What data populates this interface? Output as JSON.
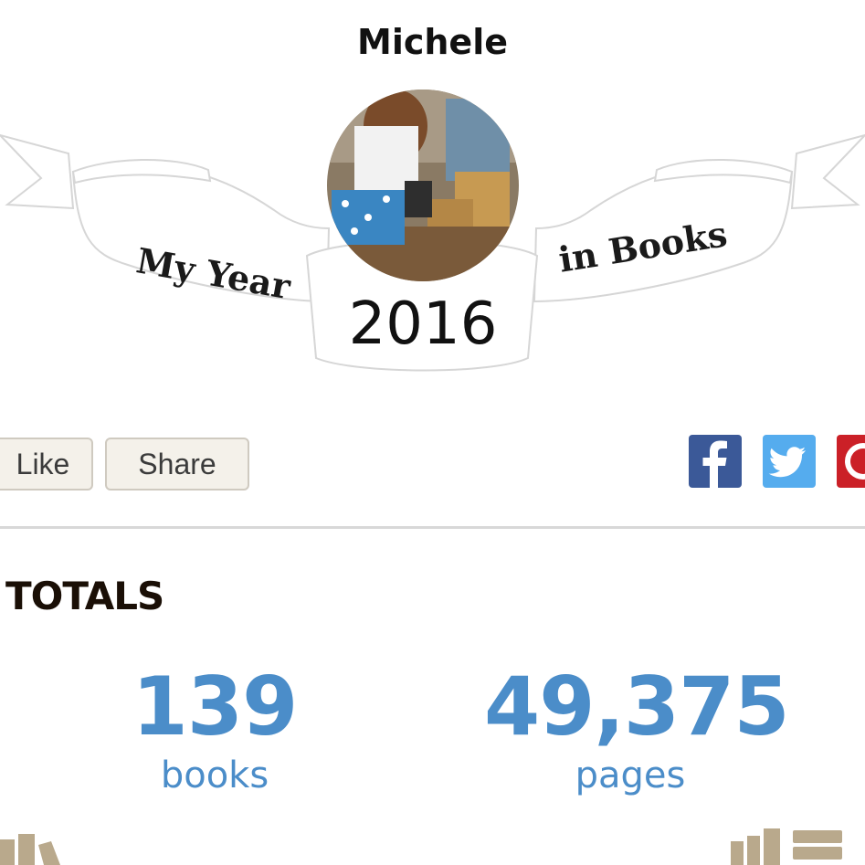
{
  "profile": {
    "name": "Michele"
  },
  "banner": {
    "left_text": "My Year",
    "right_text": "in Books",
    "year": "2016"
  },
  "actions": {
    "like_label": "Like",
    "share_label": "Share"
  },
  "social": {
    "facebook_icon": "facebook-icon",
    "twitter_icon": "twitter-icon",
    "pinterest_icon": "pinterest-icon",
    "colors": {
      "facebook": "#3b5998",
      "twitter": "#55acee",
      "pinterest": "#cb2027"
    }
  },
  "totals": {
    "heading": "TOTALS",
    "books_count": "139",
    "books_label": "books",
    "pages_count": "49,375",
    "pages_label": "pages"
  },
  "theme": {
    "stat_color": "#4b8dc9",
    "button_bg": "#f4f1ea",
    "shelf_color": "#b9a98c"
  }
}
